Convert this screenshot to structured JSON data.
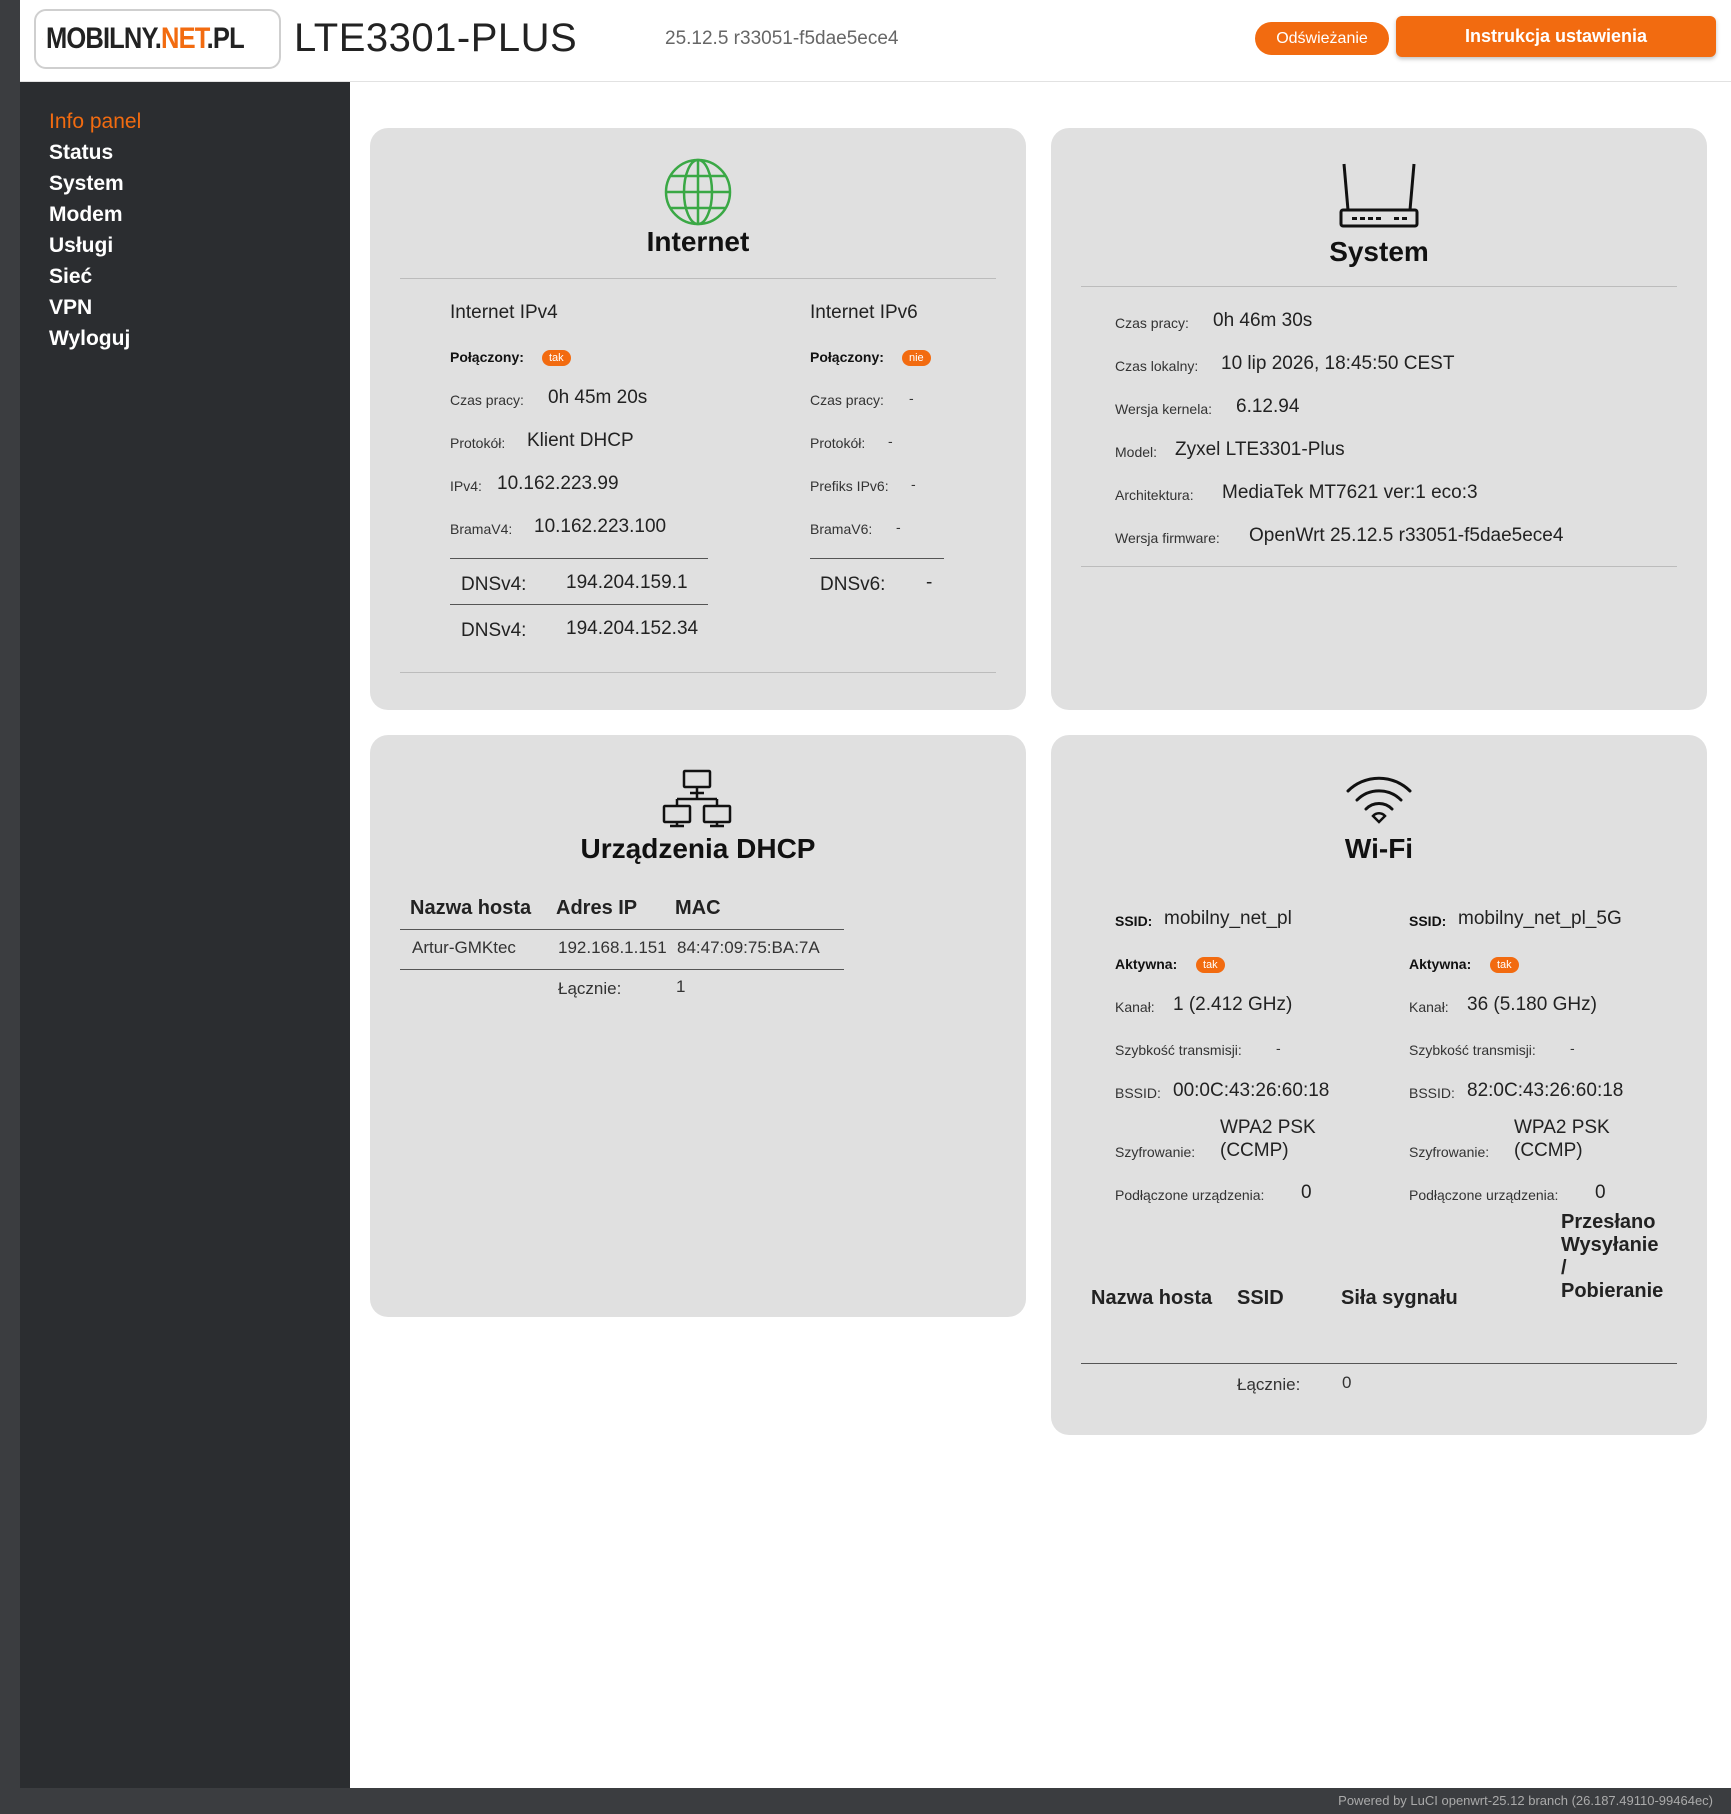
{
  "header": {
    "logo_dark": "MOBILNY.",
    "logo_orange": "NET",
    "logo_tail": ".PL",
    "device": "LTE3301-PLUS",
    "version": "25.12.5 r33051-f5dae5ece4",
    "refresh_label": "Odświeżanie",
    "guide_label": "Instrukcja ustawienia"
  },
  "sidebar": {
    "items": [
      {
        "label": "Info panel"
      },
      {
        "label": "Status"
      },
      {
        "label": "System"
      },
      {
        "label": "Modem"
      },
      {
        "label": "Usługi"
      },
      {
        "label": "Sieć"
      },
      {
        "label": "VPN"
      },
      {
        "label": "Wyloguj"
      }
    ]
  },
  "internet": {
    "title": "Internet",
    "ipv4": {
      "heading": "Internet IPv4",
      "connected_label": "Połączony:",
      "connected_badge": "tak",
      "uptime_label": "Czas pracy:",
      "uptime": "0h 45m 20s",
      "protocol_label": "Protokół:",
      "protocol": "Klient DHCP",
      "ip_label": "IPv4:",
      "ip": "10.162.223.99",
      "gw_label": "BramaV4:",
      "gw": "10.162.223.100",
      "dns_label": "DNSv4:",
      "dns1": "194.204.159.1",
      "dns2": "194.204.152.34"
    },
    "ipv6": {
      "heading": "Internet IPv6",
      "connected_label": "Połączony:",
      "connected_badge": "nie",
      "uptime_label": "Czas pracy:",
      "uptime": "-",
      "protocol_label": "Protokół:",
      "protocol": "-",
      "prefix_label": "Prefiks IPv6:",
      "prefix": "-",
      "gw_label": "BramaV6:",
      "gw": "-",
      "dns_label": "DNSv6:",
      "dns": "-"
    }
  },
  "system": {
    "title": "System",
    "uptime_label": "Czas pracy:",
    "uptime": "0h 46m 30s",
    "localtime_label": "Czas lokalny:",
    "localtime": "10 lip 2026, 18:45:50 CEST",
    "kernel_label": "Wersja kernela:",
    "kernel": "6.12.94",
    "model_label": "Model:",
    "model": "Zyxel LTE3301-Plus",
    "arch_label": "Architektura:",
    "arch": "MediaTek MT7621 ver:1 eco:3",
    "fw_label": "Wersja firmware:",
    "fw": "OpenWrt 25.12.5 r33051-f5dae5ece4"
  },
  "dhcp": {
    "title": "Urządzenia DHCP",
    "columns": [
      "Nazwa hosta",
      "Adres IP",
      "MAC"
    ],
    "rows": [
      {
        "host": "Artur-GMKtec",
        "ip": "192.168.1.151",
        "mac": "84:47:09:75:BA:7A"
      }
    ],
    "total_label": "Łącznie:",
    "total": "1"
  },
  "wifi": {
    "title": "Wi-Fi",
    "radios": [
      {
        "ssid_label": "SSID:",
        "ssid": "mobilny_net_pl",
        "active_label": "Aktywna:",
        "active_badge": "tak",
        "channel_label": "Kanał:",
        "channel": "1 (2.412 GHz)",
        "rate_label": "Szybkość transmisji:",
        "rate": "-",
        "bssid_label": "BSSID:",
        "bssid": "00:0C:43:26:60:18",
        "enc_label": "Szyfrowanie:",
        "enc_line1": "WPA2 PSK",
        "enc_line2": "(CCMP)",
        "clients_label": "Podłączone urządzenia:",
        "clients": "0"
      },
      {
        "ssid_label": "SSID:",
        "ssid": "mobilny_net_pl_5G",
        "active_label": "Aktywna:",
        "active_badge": "tak",
        "channel_label": "Kanał:",
        "channel": "36 (5.180 GHz)",
        "rate_label": "Szybkość transmisji:",
        "rate": "-",
        "bssid_label": "BSSID:",
        "bssid": "82:0C:43:26:60:18",
        "enc_label": "Szyfrowanie:",
        "enc_line1": "WPA2 PSK",
        "enc_line2": "(CCMP)",
        "clients_label": "Podłączone urządzenia:",
        "clients": "0"
      }
    ],
    "table": {
      "col_host": "Nazwa hosta",
      "col_ssid": "SSID",
      "col_signal": "Siła sygnału",
      "col_transfer_1": "Przesłano",
      "col_transfer_2": "Wysyłanie",
      "col_transfer_3": "/",
      "col_transfer_4": "Pobieranie"
    },
    "total_label": "Łącznie:",
    "total": "0"
  },
  "footer": {
    "text": "Powered by LuCI openwrt-25.12 branch (26.187.49110-99464ec)"
  },
  "colors": {
    "accent": "#f26b10",
    "sidebar_bg": "#2b2d30",
    "card_bg": "#e0e0e0",
    "globe": "#3aa845"
  },
  "icons": {
    "logo": "sim-card-icon",
    "internet": "globe-icon",
    "system": "router-icon",
    "dhcp": "network-icon",
    "wifi": "wifi-icon"
  }
}
